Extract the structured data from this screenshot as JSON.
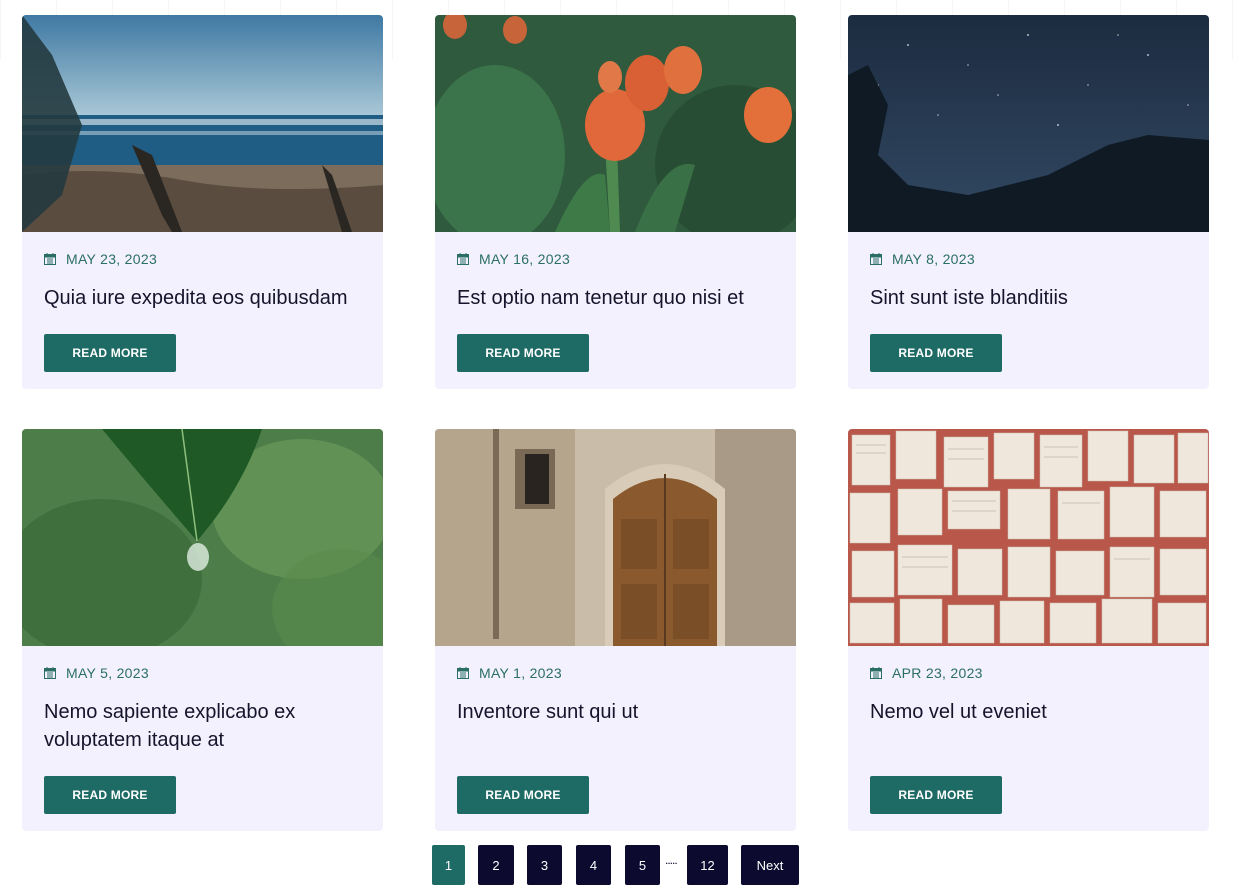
{
  "posts": [
    {
      "date": "MAY 23, 2023",
      "title": "Quia iure expedita eos quibusdam",
      "button": "READ MORE",
      "image": "beach-photo"
    },
    {
      "date": "MAY 16, 2023",
      "title": "Est optio nam tenetur quo nisi et",
      "button": "READ MORE",
      "image": "tulips-photo"
    },
    {
      "date": "MAY 8, 2023",
      "title": "Sint sunt iste blanditiis",
      "button": "READ MORE",
      "image": "night-sky-photo"
    },
    {
      "date": "MAY 5, 2023",
      "title": "Nemo sapiente explicabo ex voluptatem itaque at",
      "button": "READ MORE",
      "image": "leaf-drop-photo"
    },
    {
      "date": "MAY 1, 2023",
      "title": "Inventore sunt qui ut",
      "button": "READ MORE",
      "image": "wooden-door-photo"
    },
    {
      "date": "APR 23, 2023",
      "title": "Nemo vel ut eveniet",
      "button": "READ MORE",
      "image": "sheet-music-photo"
    }
  ],
  "pagination": {
    "pages": [
      "1",
      "2",
      "3",
      "4",
      "5"
    ],
    "ellipsis": ".....",
    "last": "12",
    "next": "Next",
    "current": "1"
  },
  "colors": {
    "accent": "#1e6a64",
    "card_bg": "#f3f1fd",
    "date_text": "#2b6e66",
    "title_text": "#15142b",
    "page_bg": "#0c0a2e"
  },
  "icons": {
    "date": "calendar-icon"
  }
}
